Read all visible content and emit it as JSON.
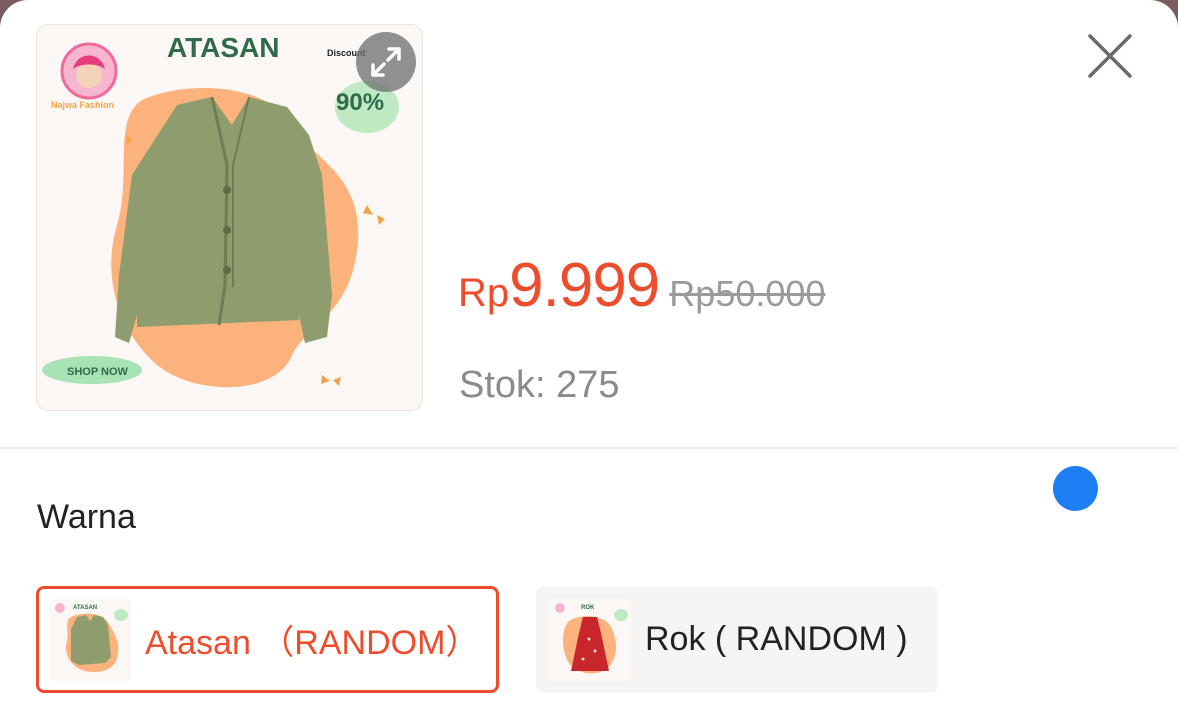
{
  "product": {
    "image_banner": {
      "title": "ATASAN",
      "discount_label": "Discount",
      "discount_value": "90%",
      "shop_now": "SHOP NOW",
      "brand": "Najwa Fashion"
    },
    "price": {
      "currency": "Rp",
      "value": "9.999",
      "original": "Rp50.000"
    },
    "stock_text": "Stok: 275"
  },
  "options": {
    "section_label": "Warna",
    "variants": [
      {
        "label": "Atasan （RANDOM）",
        "selected": true,
        "thumb_title": "ATASAN"
      },
      {
        "label": "Rok ( RANDOM )",
        "selected": false,
        "thumb_title": "ROK"
      }
    ]
  },
  "colors": {
    "accent": "#ee4d2d",
    "indicator": "#1e7ff5",
    "banner_green": "#2f6b4a",
    "cardigan": "#8e9c6e",
    "orange_blob": "#fbb27c",
    "skirt": "#c8262a"
  },
  "icons": {
    "expand": "expand-icon",
    "close": "close-icon"
  }
}
